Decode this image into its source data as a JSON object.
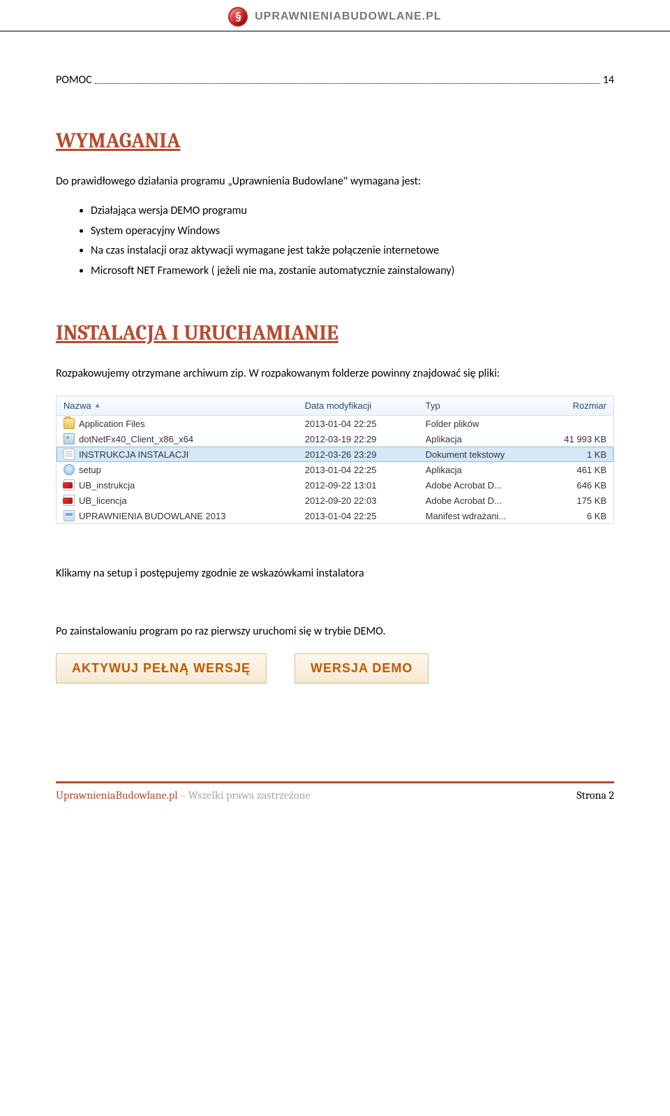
{
  "header": {
    "badge_glyph": "§",
    "site_name": "UPRAWNIENIABUDOWLANE.PL"
  },
  "toc": {
    "label": "POMOC",
    "page": "14"
  },
  "section_requirements": {
    "title": "WYMAGANIA",
    "intro": "Do prawidłowego działania programu „Uprawnienia Budowlane\" wymagana jest:",
    "items": [
      "Działająca wersja DEMO programu",
      "System operacyjny Windows",
      "Na czas instalacji oraz aktywacji wymagane jest także połączenie internetowe",
      "Microsoft NET Framework ( jeżeli nie ma, zostanie automatycznie zainstalowany)"
    ]
  },
  "section_install": {
    "title": "INSTALACJA I URUCHAMIANIE",
    "para1": "Rozpakowujemy otrzymane archiwum zip. W rozpakowanym folderze powinny znajdować się pliki:",
    "para2": "Klikamy na setup i postępujemy zgodnie ze wskazówkami instalatora",
    "para3": "Po zainstalowaniu program po raz pierwszy uruchomi się w trybie DEMO."
  },
  "explorer": {
    "columns": {
      "name": "Nazwa",
      "date": "Data modyfikacji",
      "type": "Typ",
      "size": "Rozmiar"
    },
    "rows": [
      {
        "icon": "folder",
        "name": "Application Files",
        "date": "2013-01-04 22:25",
        "type": "Folder plików",
        "size": "",
        "selected": false
      },
      {
        "icon": "exe",
        "name": "dotNetFx40_Client_x86_x64",
        "date": "2012-03-19 22:29",
        "type": "Aplikacja",
        "size": "41 993 KB",
        "selected": false
      },
      {
        "icon": "txt",
        "name": "INSTRUKCJA INSTALACJI",
        "date": "2012-03-26 23:29",
        "type": "Dokument tekstowy",
        "size": "1 KB",
        "selected": true
      },
      {
        "icon": "setup",
        "name": "setup",
        "date": "2013-01-04 22:25",
        "type": "Aplikacja",
        "size": "461 KB",
        "selected": false
      },
      {
        "icon": "pdf",
        "name": "UB_instrukcja",
        "date": "2012-09-22 13:01",
        "type": "Adobe Acrobat D...",
        "size": "646 KB",
        "selected": false
      },
      {
        "icon": "pdf",
        "name": "UB_licencja",
        "date": "2012-09-20 22:03",
        "type": "Adobe Acrobat D...",
        "size": "175 KB",
        "selected": false
      },
      {
        "icon": "manifest",
        "name": "UPRAWNIENIA BUDOWLANE 2013",
        "date": "2013-01-04 22:25",
        "type": "Manifest wdrażani...",
        "size": "6 KB",
        "selected": false
      }
    ]
  },
  "buttons": {
    "full": "AKTYWUJ PEŁNĄ WERSJĘ",
    "demo": "WERSJA DEMO"
  },
  "footer": {
    "site": "UprawnieniaBudowlane.pl",
    "rights": " – Wszelki prawa zastrzeżone",
    "page_label": "Strona 2"
  }
}
